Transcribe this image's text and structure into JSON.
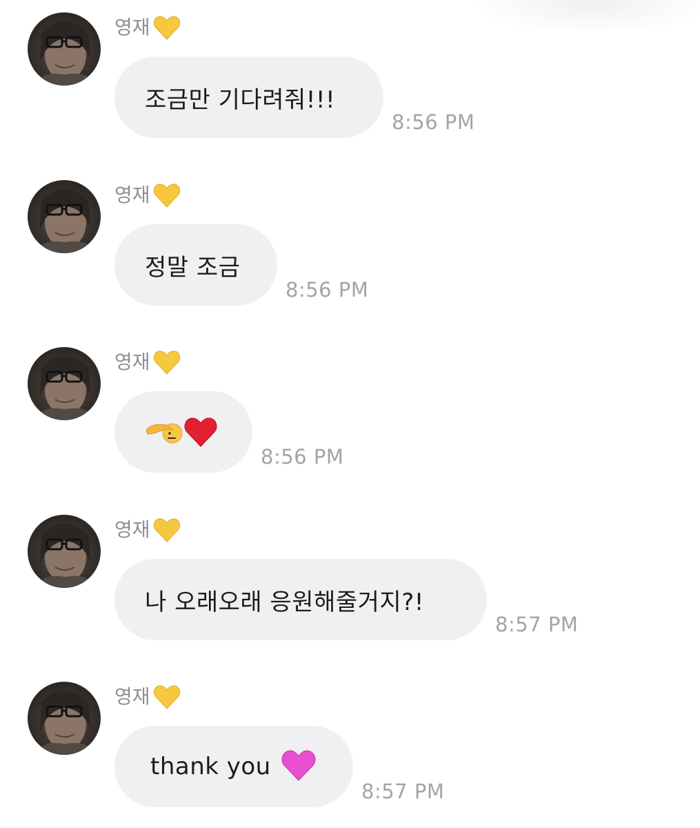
{
  "messages": [
    {
      "sender": "영재",
      "text": "조금만 기다려줘!!!",
      "time": "8:56 PM"
    },
    {
      "sender": "영재",
      "text": "정말 조금",
      "time": "8:56 PM"
    },
    {
      "sender": "영재",
      "emojis": [
        "saluting-face",
        "red-heart"
      ],
      "time": "8:56 PM"
    },
    {
      "sender": "영재",
      "text": "나 오래오래 응원해줄거지?!",
      "time": "8:57 PM"
    },
    {
      "sender": "영재",
      "text": "thank you",
      "emoji": "pink-heart",
      "time": "8:57 PM"
    }
  ],
  "icons": {
    "sender_badge": "yellow-heart-icon"
  },
  "colors": {
    "bubble": "#f0f0f3",
    "sender_text": "#8e8e93",
    "time_text": "#a4a4a8",
    "message_text": "#1c1c1e",
    "yellow_heart": "#f6c83d",
    "red_heart": "#e3202f",
    "pink_heart": "#e94fd1"
  }
}
